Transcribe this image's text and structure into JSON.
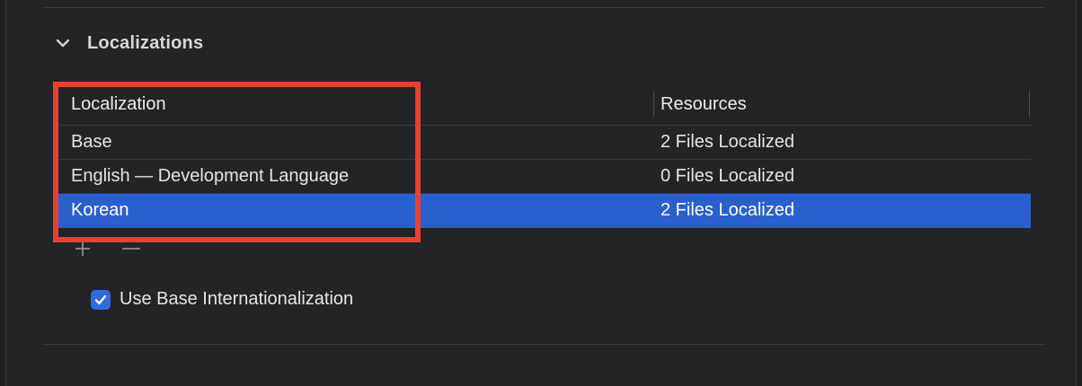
{
  "section": {
    "title": "Localizations"
  },
  "table": {
    "headers": {
      "localization": "Localization",
      "resources": "Resources"
    },
    "rows": [
      {
        "localization": "Base",
        "resources": "2 Files Localized",
        "selected": false
      },
      {
        "localization": "English — Development Language",
        "resources": "0 Files Localized",
        "selected": false
      },
      {
        "localization": "Korean",
        "resources": "2 Files Localized",
        "selected": true
      }
    ]
  },
  "toolbar": {
    "add_icon": "plus-icon",
    "remove_icon": "minus-icon"
  },
  "options": {
    "use_base_internationalization": {
      "label": "Use Base Internationalization",
      "checked": true
    }
  },
  "colors": {
    "selection": "#2a5fce",
    "highlight_box": "#e8412e",
    "checkbox": "#2f6bde"
  }
}
